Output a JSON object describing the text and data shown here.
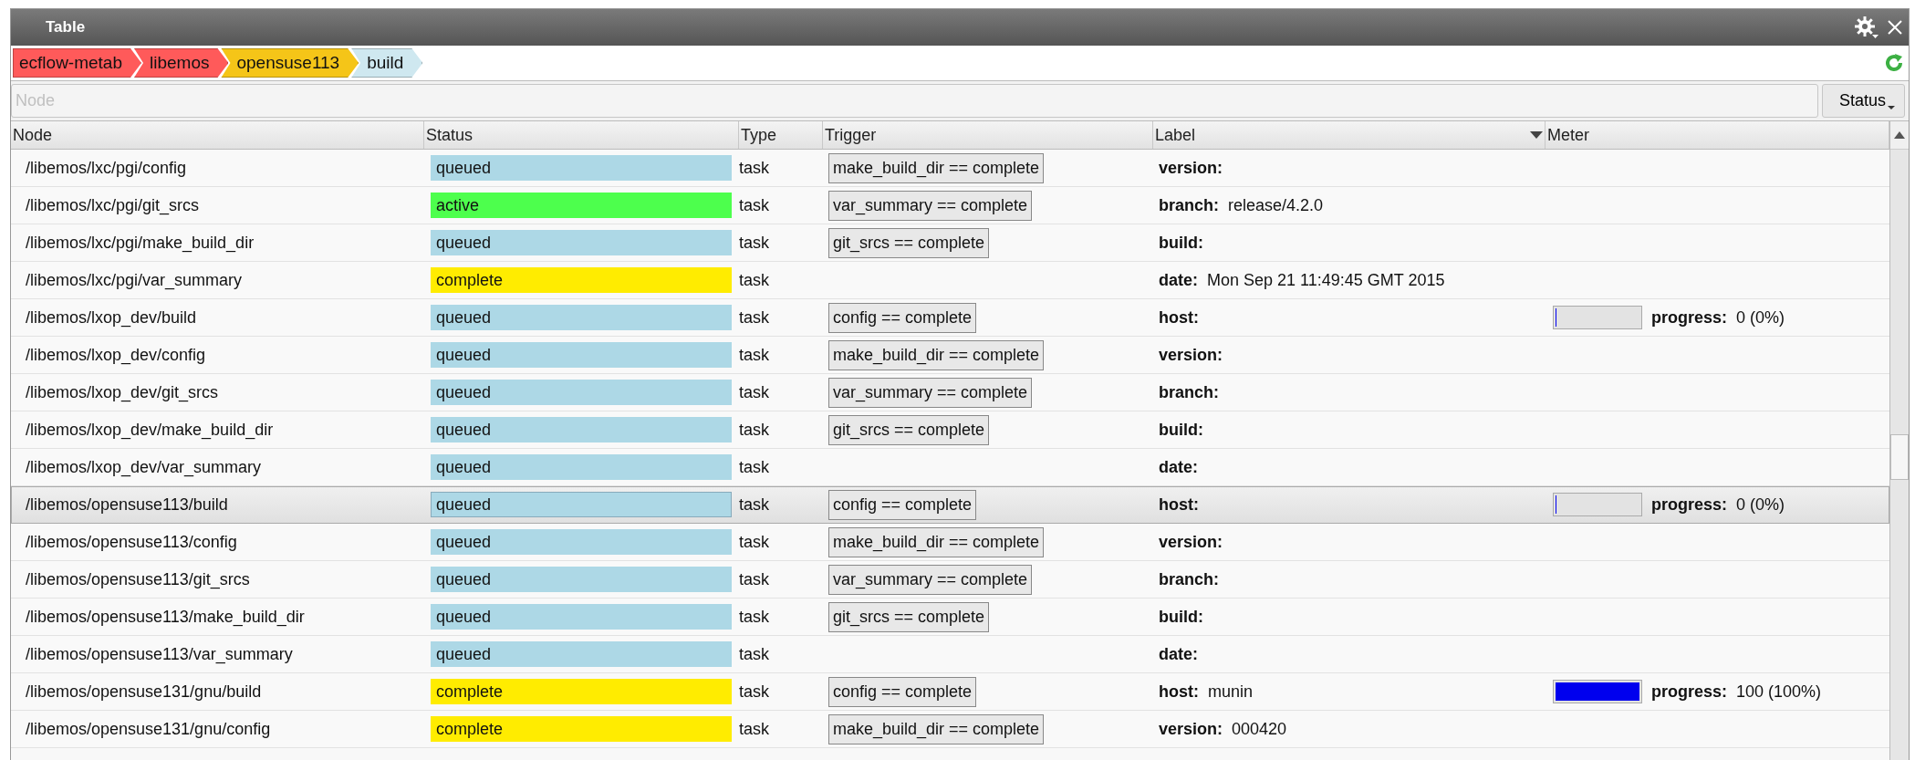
{
  "window": {
    "title": "Table"
  },
  "breadcrumb": [
    {
      "label": "ecflow-metab",
      "color": "#ff5a5a"
    },
    {
      "label": "libemos",
      "color": "#ff5a5a"
    },
    {
      "label": "opensuse113",
      "color": "#f5c518"
    },
    {
      "label": "build",
      "color": "#cfe8f0"
    }
  ],
  "filter": {
    "placeholder": "Node",
    "status_button": "Status"
  },
  "table": {
    "columns": [
      "Node",
      "Status",
      "Type",
      "Trigger",
      "Label",
      "Meter"
    ],
    "rows": [
      {
        "node": "/libemos/lxc/pgi/config",
        "status": {
          "text": "queued",
          "color": "#add8e6"
        },
        "type": "task",
        "trigger": "make_build_dir == complete",
        "label": {
          "key": "version:"
        },
        "selected": false
      },
      {
        "node": "/libemos/lxc/pgi/git_srcs",
        "status": {
          "text": "active",
          "color": "#4dff4d"
        },
        "type": "task",
        "trigger": "var_summary == complete",
        "label": {
          "key": "branch:",
          "value": "release/4.2.0"
        },
        "selected": false
      },
      {
        "node": "/libemos/lxc/pgi/make_build_dir",
        "status": {
          "text": "queued",
          "color": "#add8e6"
        },
        "type": "task",
        "trigger": "git_srcs == complete",
        "label": {
          "key": "build:"
        },
        "selected": false
      },
      {
        "node": "/libemos/lxc/pgi/var_summary",
        "status": {
          "text": "complete",
          "color": "#ffec00"
        },
        "type": "task",
        "label": {
          "key": "date:",
          "value": "Mon Sep 21 11:49:45 GMT 2015"
        },
        "selected": false
      },
      {
        "node": "/libemos/lxop_dev/build",
        "status": {
          "text": "queued",
          "color": "#add8e6"
        },
        "type": "task",
        "trigger": "config == complete",
        "label": {
          "key": "host:"
        },
        "meter": {
          "level": 0,
          "label": "progress:",
          "value": "0 (0%)"
        },
        "selected": false
      },
      {
        "node": "/libemos/lxop_dev/config",
        "status": {
          "text": "queued",
          "color": "#add8e6"
        },
        "type": "task",
        "trigger": "make_build_dir == complete",
        "label": {
          "key": "version:"
        },
        "selected": false
      },
      {
        "node": "/libemos/lxop_dev/git_srcs",
        "status": {
          "text": "queued",
          "color": "#add8e6"
        },
        "type": "task",
        "trigger": "var_summary == complete",
        "label": {
          "key": "branch:"
        },
        "selected": false
      },
      {
        "node": "/libemos/lxop_dev/make_build_dir",
        "status": {
          "text": "queued",
          "color": "#add8e6"
        },
        "type": "task",
        "trigger": "git_srcs == complete",
        "label": {
          "key": "build:"
        },
        "selected": false
      },
      {
        "node": "/libemos/lxop_dev/var_summary",
        "status": {
          "text": "queued",
          "color": "#add8e6"
        },
        "type": "task",
        "label": {
          "key": "date:"
        },
        "selected": false
      },
      {
        "node": "/libemos/opensuse113/build",
        "status": {
          "text": "queued",
          "color": "#add8e6"
        },
        "type": "task",
        "trigger": "config == complete",
        "label": {
          "key": "host:"
        },
        "meter": {
          "level": 0,
          "label": "progress:",
          "value": "0 (0%)"
        },
        "selected": true
      },
      {
        "node": "/libemos/opensuse113/config",
        "status": {
          "text": "queued",
          "color": "#add8e6"
        },
        "type": "task",
        "trigger": "make_build_dir == complete",
        "label": {
          "key": "version:"
        },
        "selected": false
      },
      {
        "node": "/libemos/opensuse113/git_srcs",
        "status": {
          "text": "queued",
          "color": "#add8e6"
        },
        "type": "task",
        "trigger": "var_summary == complete",
        "label": {
          "key": "branch:"
        },
        "selected": false
      },
      {
        "node": "/libemos/opensuse113/make_build_dir",
        "status": {
          "text": "queued",
          "color": "#add8e6"
        },
        "type": "task",
        "trigger": "git_srcs == complete",
        "label": {
          "key": "build:"
        },
        "selected": false
      },
      {
        "node": "/libemos/opensuse113/var_summary",
        "status": {
          "text": "queued",
          "color": "#add8e6"
        },
        "type": "task",
        "label": {
          "key": "date:"
        },
        "selected": false
      },
      {
        "node": "/libemos/opensuse131/gnu/build",
        "status": {
          "text": "complete",
          "color": "#ffec00"
        },
        "type": "task",
        "trigger": "config == complete",
        "label": {
          "key": "host:",
          "value": "munin"
        },
        "meter": {
          "level": 1,
          "label": "progress:",
          "value": "100 (100%)"
        },
        "selected": false
      },
      {
        "node": "/libemos/opensuse131/gnu/config",
        "status": {
          "text": "complete",
          "color": "#ffec00"
        },
        "type": "task",
        "trigger": "make_build_dir == complete",
        "label": {
          "key": "version:",
          "value": "000420"
        },
        "selected": false
      }
    ]
  }
}
